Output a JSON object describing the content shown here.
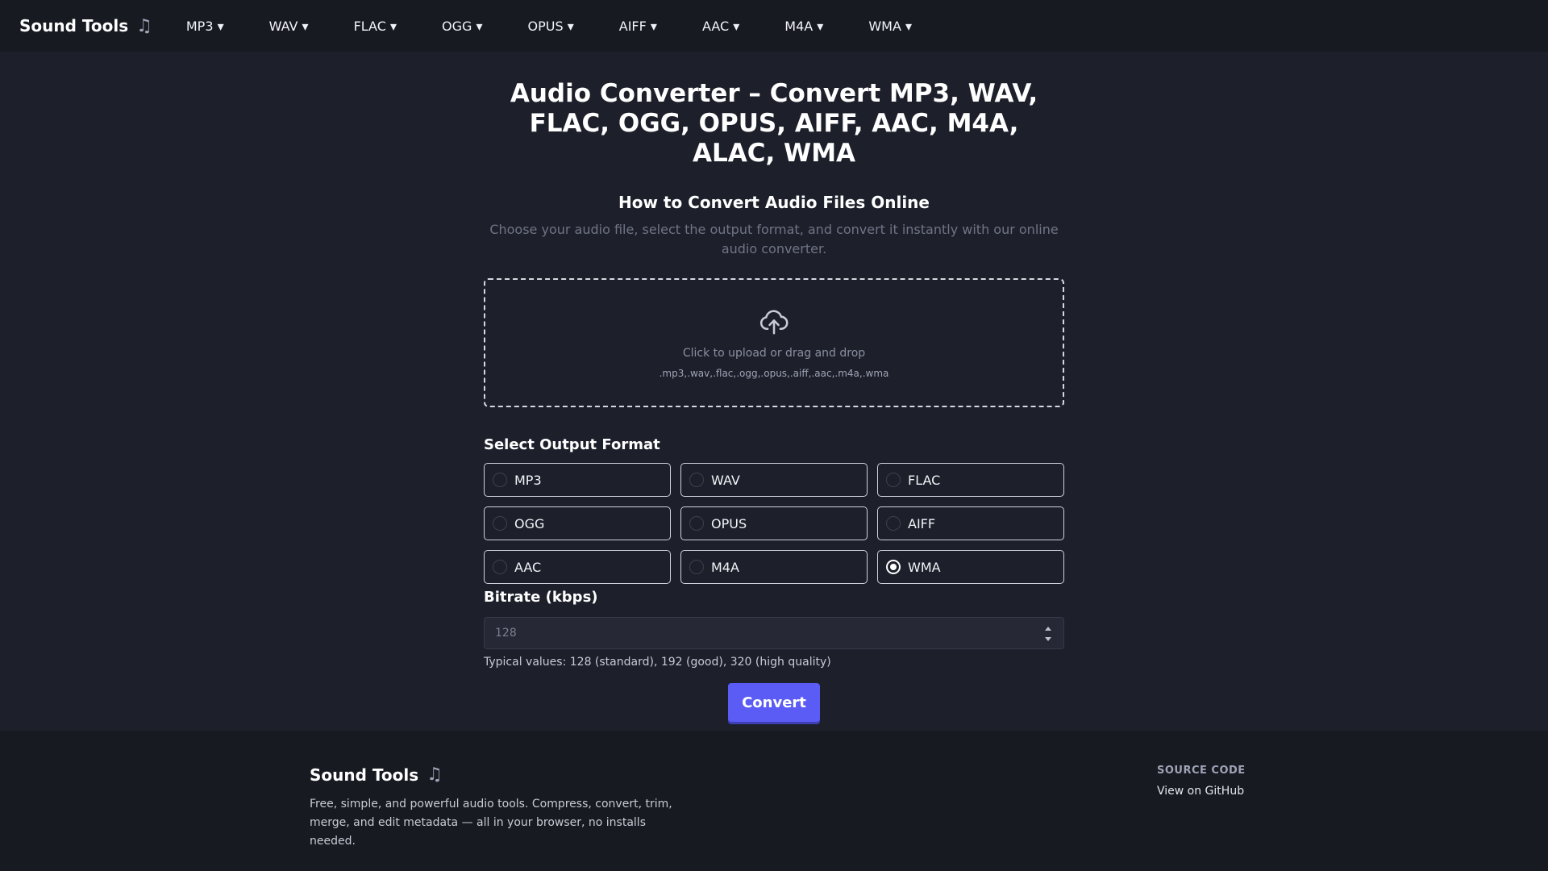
{
  "header": {
    "brand": "Sound Tools",
    "nav": [
      "MP3 ▾",
      "WAV ▾",
      "FLAC ▾",
      "OGG ▾",
      "OPUS ▾",
      "AIFF ▾",
      "AAC ▾",
      "M4A ▾",
      "WMA ▾"
    ]
  },
  "main": {
    "title": "Audio Converter – Convert MP3, WAV, FLAC, OGG, OPUS, AIFF, AAC, M4A, ALAC, WMA",
    "how_title": "How to Convert Audio Files Online",
    "how_desc": "Choose your audio file, select the output format, and convert it instantly with our online audio converter.",
    "dropzone": {
      "text": "Click to upload or drag and drop",
      "types": ".mp3,.wav,.flac,.ogg,.opus,.aiff,.aac,.m4a,.wma"
    },
    "format_title": "Select Output Format",
    "formats": [
      "MP3",
      "WAV",
      "FLAC",
      "OGG",
      "OPUS",
      "AIFF",
      "AAC",
      "M4A",
      "WMA"
    ],
    "selected_format": "WMA",
    "bitrate_title": "Bitrate (kbps)",
    "bitrate_value": "128",
    "bitrate_hint": "Typical values: 128 (standard), 192 (good), 320 (high quality)",
    "convert_label": "Convert"
  },
  "footer": {
    "brand": "Sound Tools",
    "desc": "Free, simple, and powerful audio tools. Compress, convert, trim, merge, and edit metadata — all in your browser, no installs needed.",
    "source_title": "SOURCE CODE",
    "github_link": "View on GitHub"
  },
  "icons": {
    "brand_icon": "music-note-icon",
    "upload_icon": "cloud-upload-icon"
  },
  "colors": {
    "accent": "#5b5cf6",
    "background": "#1d202b",
    "header_bg": "#181a22"
  }
}
